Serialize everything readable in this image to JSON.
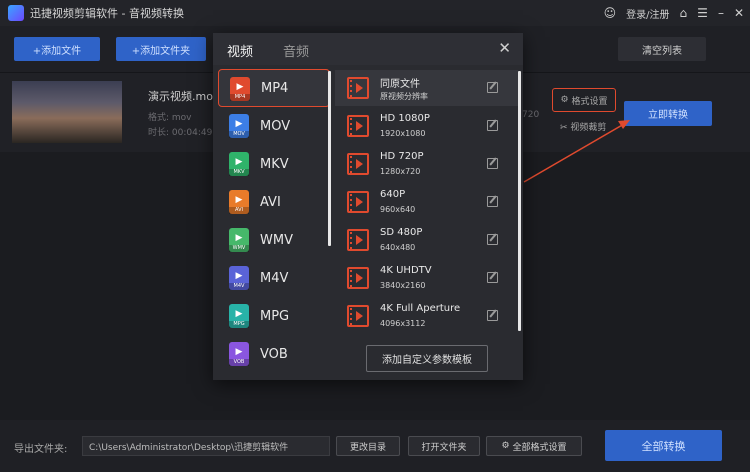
{
  "app": {
    "title": "迅捷视频剪辑软件 - 音视频转换",
    "login": "登录/注册"
  },
  "toolbar": {
    "add_file": "+添加文件",
    "add_folder": "+添加文件夹",
    "clear_list": "清空列表"
  },
  "file": {
    "name": "演示视频.mov",
    "format_meta": "格式: mov",
    "duration_meta": "时长: 00:04:49",
    "size_fragment": "720",
    "format_settings": "格式设置",
    "video_clip": "视频裁剪",
    "convert_now": "立即转换"
  },
  "dialog": {
    "tabs": [
      "视频",
      "音频"
    ],
    "formats": [
      {
        "label": "MP4",
        "color": "#e04a2e",
        "glyph": "▶",
        "tag": "MP4"
      },
      {
        "label": "MOV",
        "color": "#3c7ee6",
        "glyph": "▶",
        "tag": "MOV"
      },
      {
        "label": "MKV",
        "color": "#2fb36a",
        "glyph": "▶",
        "tag": "MKV"
      },
      {
        "label": "AVI",
        "color": "#e87b2a",
        "glyph": "▶",
        "tag": "AVI"
      },
      {
        "label": "WMV",
        "color": "#46b86a",
        "glyph": "▶",
        "tag": "WMV"
      },
      {
        "label": "M4V",
        "color": "#5a63d8",
        "glyph": "▶",
        "tag": "M4V"
      },
      {
        "label": "MPG",
        "color": "#28b3a8",
        "glyph": "▶",
        "tag": "MPG"
      },
      {
        "label": "VOB",
        "color": "#8a56e0",
        "glyph": "▶",
        "tag": "VOB"
      }
    ],
    "resolutions": [
      {
        "name": "同原文件",
        "sub": "原视频分辨率"
      },
      {
        "name": "HD 1080P",
        "sub": "1920x1080"
      },
      {
        "name": "HD 720P",
        "sub": "1280x720"
      },
      {
        "name": "640P",
        "sub": "960x640"
      },
      {
        "name": "SD 480P",
        "sub": "640x480"
      },
      {
        "name": "4K UHDTV",
        "sub": "3840x2160"
      },
      {
        "name": "4K Full Aperture",
        "sub": "4096x3112"
      }
    ],
    "custom_template": "添加自定义参数模板"
  },
  "bottom": {
    "export_label": "导出文件夹:",
    "export_path": "C:\\Users\\Administrator\\Desktop\\迅捷剪辑软件",
    "change_dir": "更改目录",
    "open_folder": "打开文件夹",
    "all_format": "全部格式设置",
    "convert_all": "全部转换"
  },
  "colors": {
    "accent": "#2f63c8",
    "highlight": "#e04a2e"
  }
}
